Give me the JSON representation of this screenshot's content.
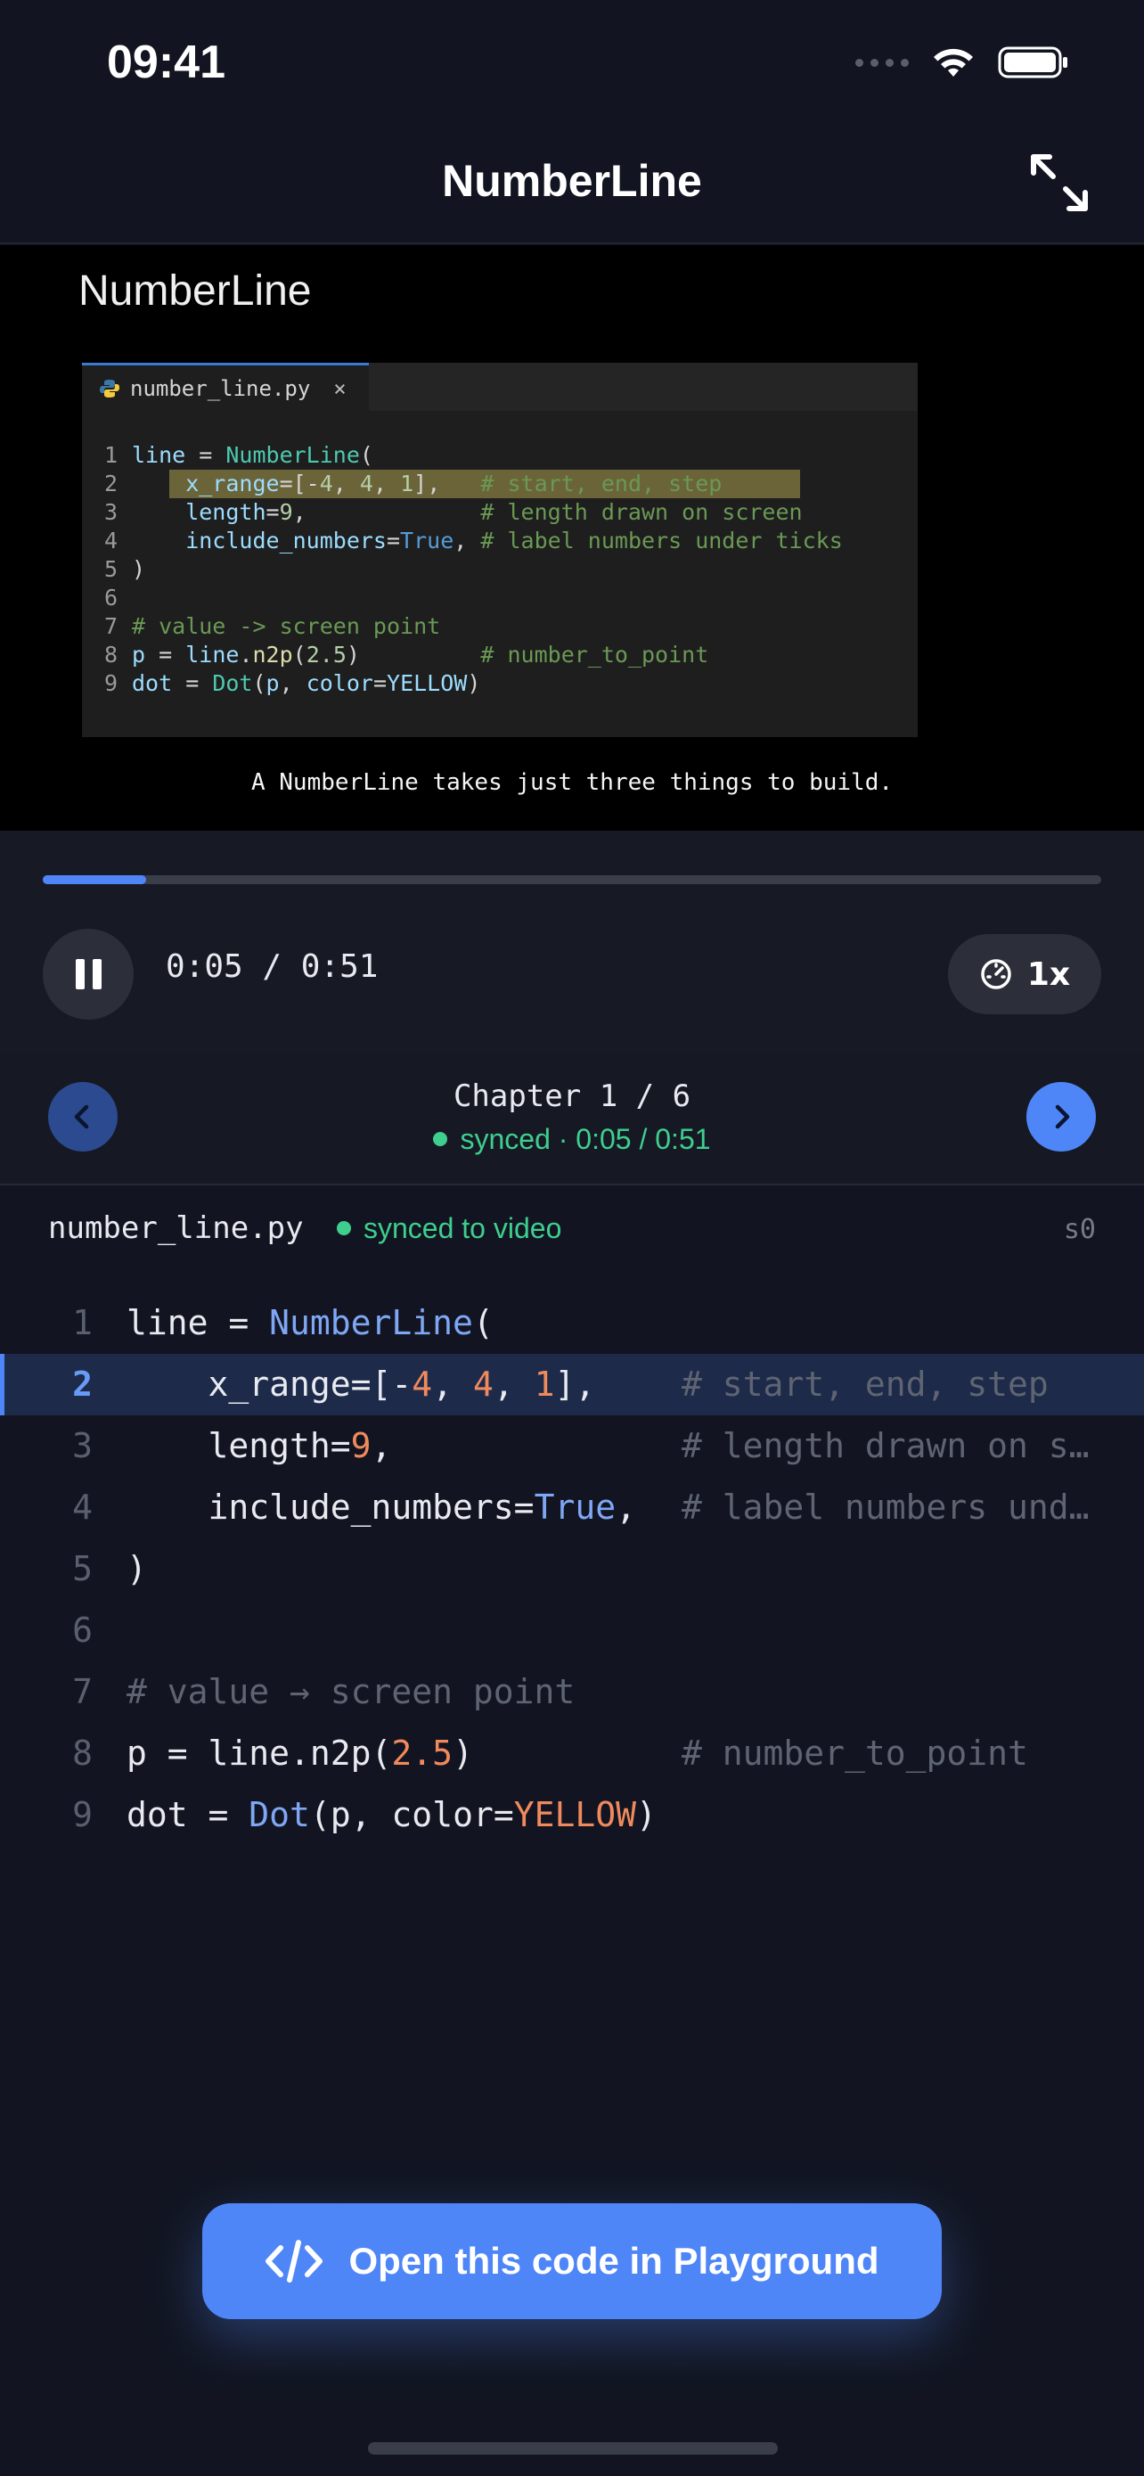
{
  "status_bar": {
    "time": "09:41"
  },
  "header": {
    "title": "NumberLine"
  },
  "video": {
    "title": "NumberLine",
    "editor_tab": "number_line.py",
    "caption": "A NumberLine takes just three things to build.",
    "line_numbers": [
      "1",
      "2",
      "3",
      "4",
      "5",
      "6",
      "7",
      "8",
      "9"
    ]
  },
  "player": {
    "time": "0:05 / 0:51",
    "progress_fraction": 0.098,
    "speed": "1x"
  },
  "chapter": {
    "label": "Chapter 1 / 6",
    "sync": "synced · 0:05 / 0:51"
  },
  "file": {
    "name": "number_line.py",
    "sync": "synced to video",
    "step": "s0"
  },
  "code": {
    "line_numbers": [
      "1",
      "2",
      "3",
      "4",
      "5",
      "6",
      "7",
      "8",
      "9"
    ],
    "active_line": 2,
    "comments": {
      "l2": "# start, end, step",
      "l3": "# length drawn on s…",
      "l4": "# label numbers und…",
      "l7": "# value → screen point",
      "l8": "# number_to_point"
    }
  },
  "cta": {
    "label": "Open this code in Playground"
  },
  "colors": {
    "accent": "#4f86f7",
    "synced": "#3ecf8e",
    "background": "#121521"
  }
}
